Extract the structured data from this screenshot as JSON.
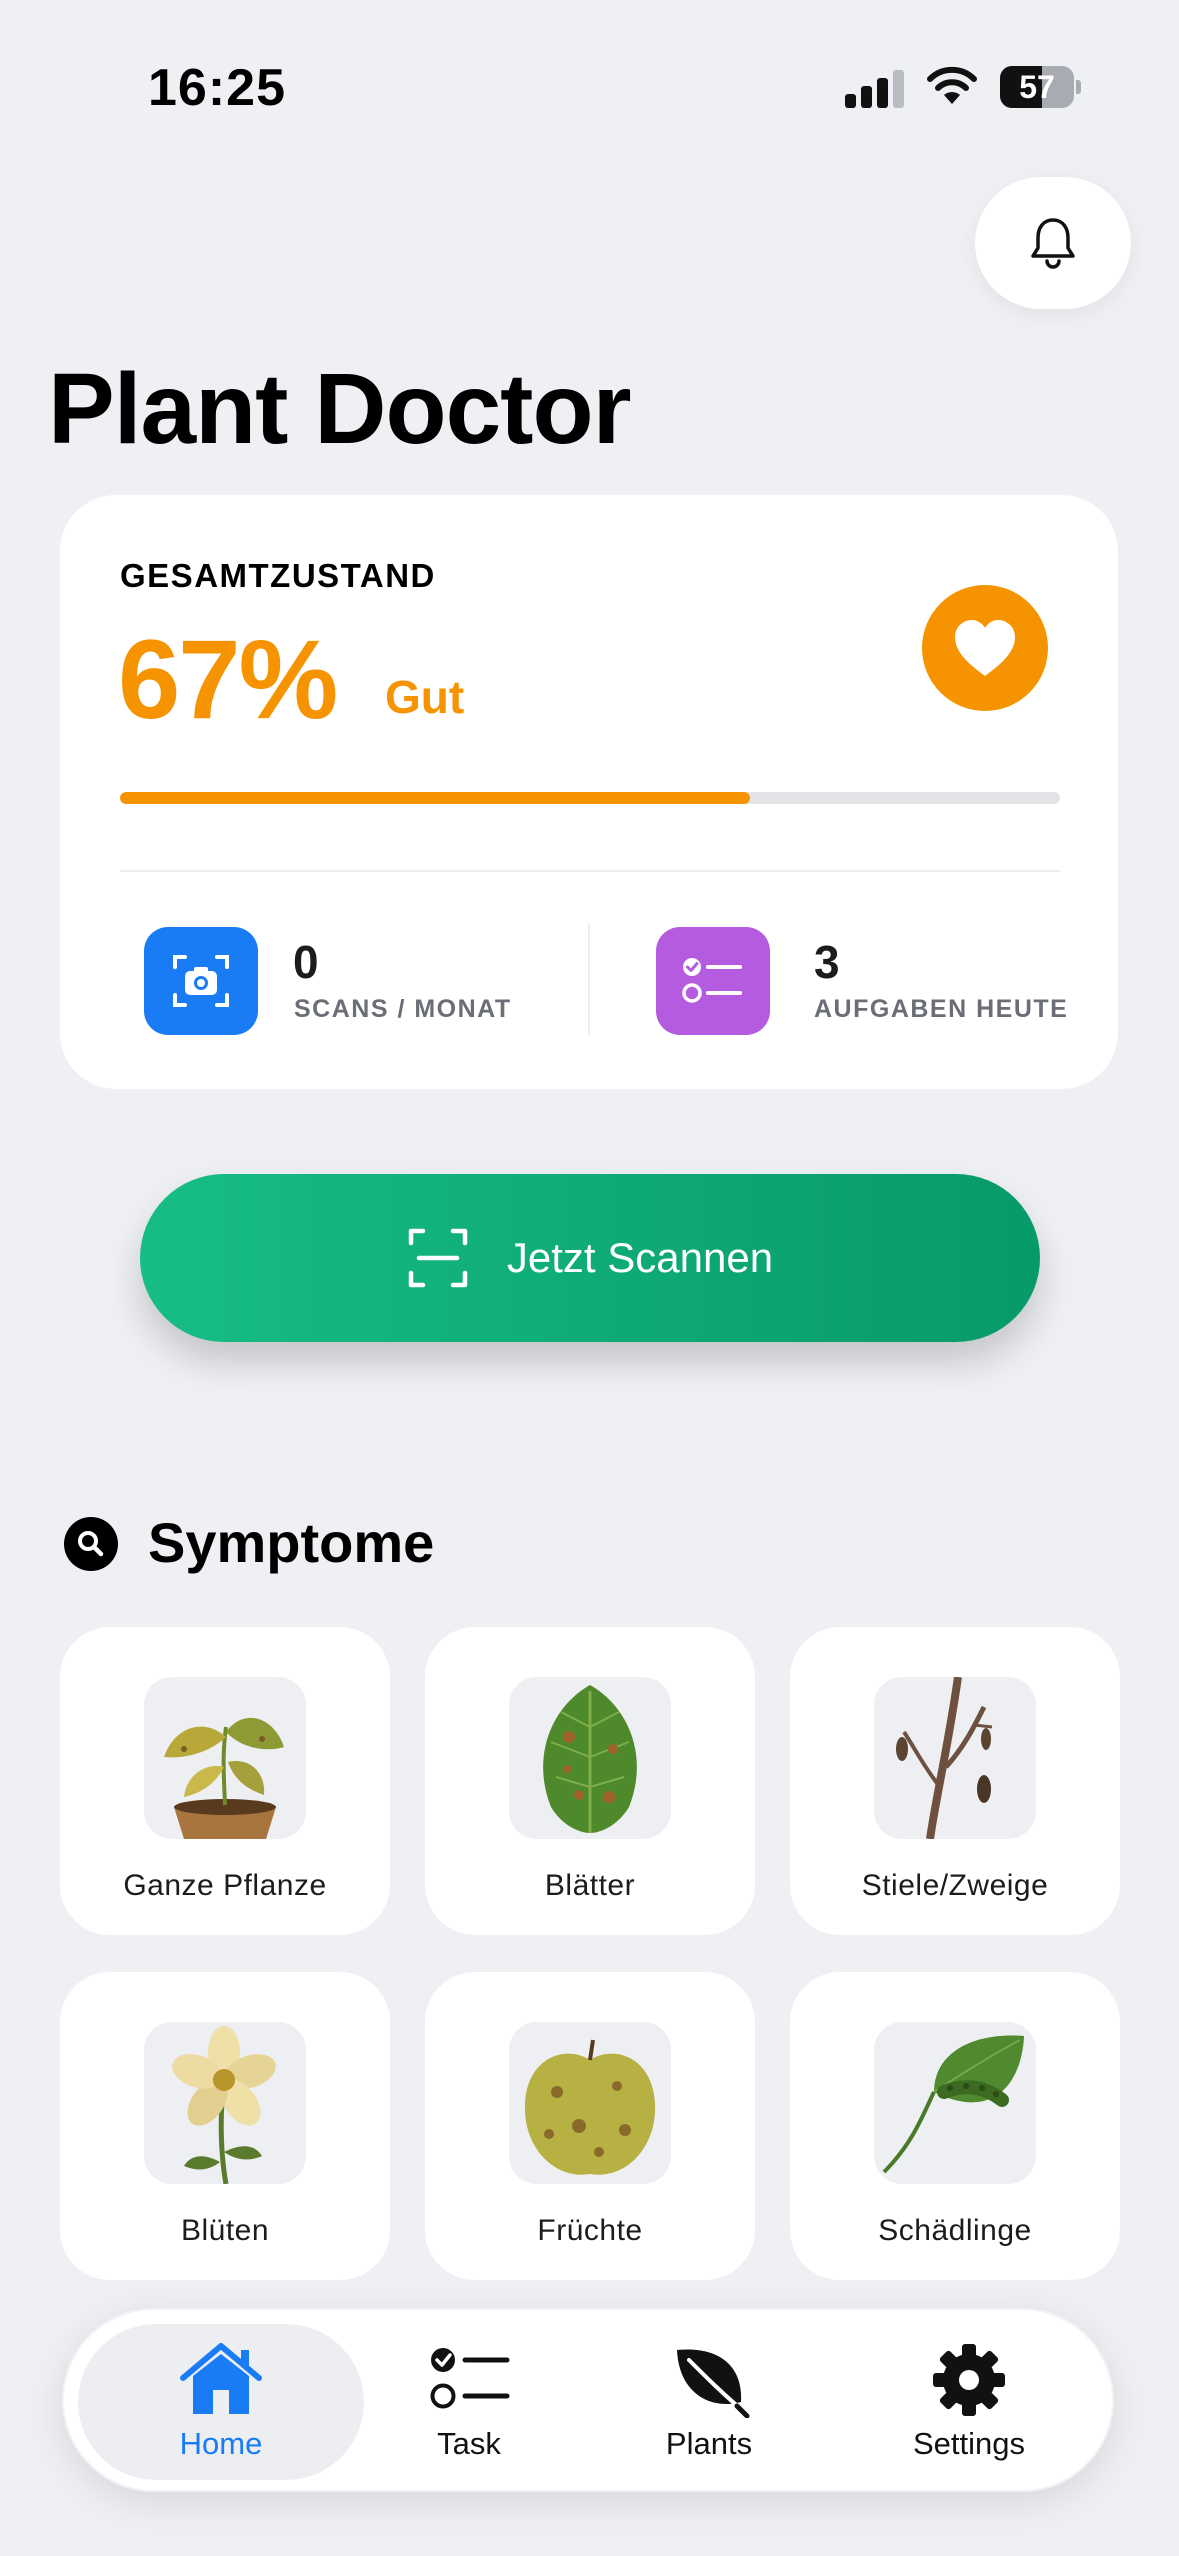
{
  "status_bar": {
    "time": "16:25",
    "battery": "57"
  },
  "header": {
    "title": "Plant Doctor",
    "notification_icon": "bell-icon"
  },
  "health": {
    "label": "GESAMTZUSTAND",
    "percent_text": "67%",
    "percent_value": 67,
    "status": "Gut",
    "accent_color": "#f59300",
    "stats": [
      {
        "value": "0",
        "label": "SCANS / MONAT",
        "icon": "camera-icon",
        "color": "#1a7cf5"
      },
      {
        "value": "3",
        "label": "AUFGABEN HEUTE",
        "icon": "checklist-icon",
        "color": "#b45be0"
      }
    ]
  },
  "scan_button": {
    "label": "Jetzt Scannen",
    "icon": "scan-icon",
    "color": "#10ad78"
  },
  "symptoms": {
    "title": "Symptome",
    "icon": "search-icon",
    "items": [
      {
        "label": "Ganze Pflanze"
      },
      {
        "label": "Blätter"
      },
      {
        "label": "Stiele/Zweige"
      },
      {
        "label": "Blüten"
      },
      {
        "label": "Früchte"
      },
      {
        "label": "Schädlinge"
      }
    ]
  },
  "tabs": [
    {
      "label": "Home",
      "icon": "home-icon",
      "active": true
    },
    {
      "label": "Task",
      "icon": "checklist-icon",
      "active": false
    },
    {
      "label": "Plants",
      "icon": "leaf-icon",
      "active": false
    },
    {
      "label": "Settings",
      "icon": "gear-icon",
      "active": false
    }
  ]
}
